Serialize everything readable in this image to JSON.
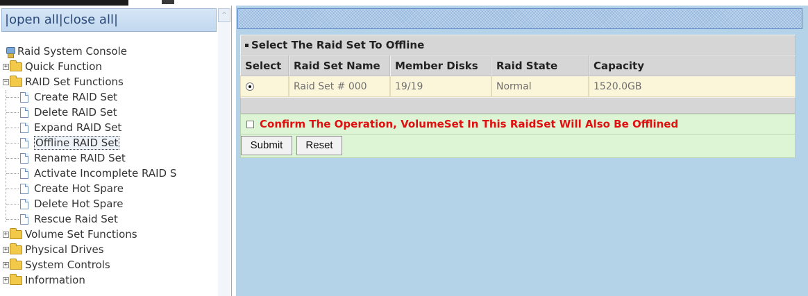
{
  "tree_controls": {
    "open_all": "open all",
    "close_all": "close all",
    "sep": "|"
  },
  "tree": {
    "root": "Raid System Console",
    "quick_function": "Quick Function",
    "raid_set_functions": "RAID Set Functions",
    "raid_children": [
      "Create RAID Set",
      "Delete RAID Set",
      "Expand RAID Set",
      "Offline RAID Set",
      "Rename RAID Set",
      "Activate Incomplete RAID S",
      "Create Hot Spare",
      "Delete Hot Spare",
      "Rescue Raid Set"
    ],
    "volume_set_functions": "Volume Set Functions",
    "physical_drives": "Physical Drives",
    "system_controls": "System Controls",
    "information": "Information",
    "selected": "Offline RAID Set"
  },
  "panel": {
    "title": "Select The Raid Set To Offline",
    "columns": [
      "Select",
      "Raid Set Name",
      "Member Disks",
      "Raid State",
      "Capacity"
    ],
    "rows": [
      {
        "selected": true,
        "name": "Raid Set # 000",
        "members": "19/19",
        "state": "Normal",
        "capacity": "1520.0GB"
      }
    ],
    "confirm_label": "Confirm The Operation, VolumeSet In This RaidSet Will Also Be Offlined",
    "submit_label": "Submit",
    "reset_label": "Reset"
  },
  "colors": {
    "right_bg": "#b4d3e8",
    "row_bg": "#fbf6d9",
    "confirm_bg": "#ddf5d4",
    "confirm_text": "#e01010"
  }
}
